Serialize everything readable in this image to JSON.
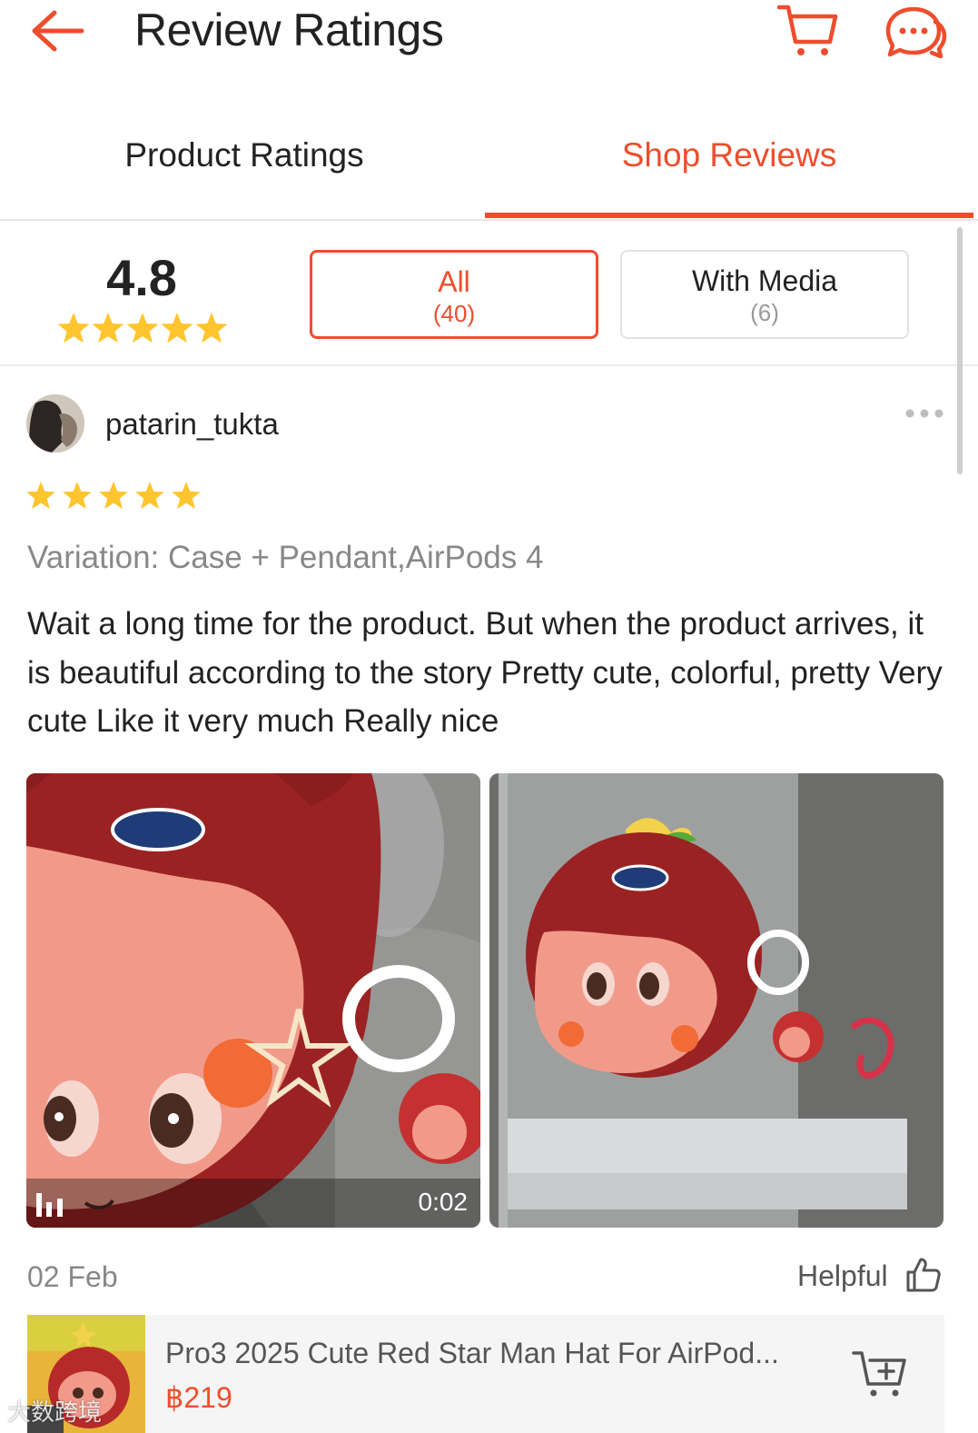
{
  "header": {
    "title": "Review Ratings",
    "back_icon": "arrow-left-icon",
    "cart_icon": "cart-icon",
    "chat_icon": "chat-icon",
    "accent_color": "#ee4d2d"
  },
  "tabs": [
    {
      "label": "Product Ratings",
      "active": false
    },
    {
      "label": "Shop Reviews",
      "active": true
    }
  ],
  "summary": {
    "score": "4.8",
    "stars": 5,
    "filters": [
      {
        "label": "All",
        "count": "(40)",
        "selected": true
      },
      {
        "label": "With Media",
        "count": "(6)",
        "selected": false
      }
    ]
  },
  "review": {
    "username": "patarin_tukta",
    "rating": 5,
    "variation": "Variation: Case + Pendant,AirPods 4",
    "text": "Wait a long time for the product. But when the product arrives, it is beautiful according to the story Pretty cute, colorful, pretty Very cute Like it very much Really nice",
    "media": [
      {
        "type": "video",
        "duration": "0:02"
      },
      {
        "type": "image"
      }
    ],
    "date": "02 Feb",
    "helpful_label": "Helpful"
  },
  "product": {
    "name": "Pro3 2025 Cute Red Star Man Hat For AirPod...",
    "price": "฿219"
  },
  "watermark": "大数跨境"
}
